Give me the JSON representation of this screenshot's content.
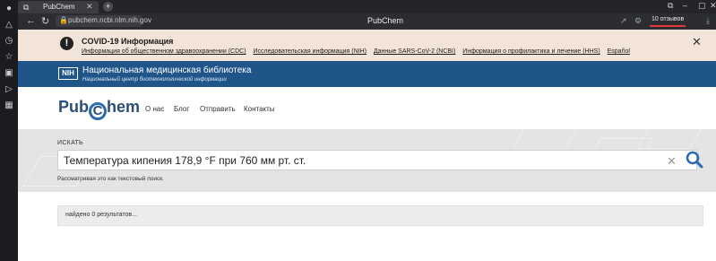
{
  "browser": {
    "tab": {
      "title": "PubChem",
      "favicon": "copy-icon"
    },
    "url": "pubchem.ncbi.nlm.nih.gov",
    "page_title": "PubChem",
    "reviews_label": "10 отзывов"
  },
  "covid": {
    "title": "COVID-19 Информация",
    "links": [
      "Информация об общественном здравоохранении (CDC)",
      "Исследовательская информация (NIH)",
      "Данные SARS-CoV-2 (NCBI)",
      "Информация о профилактика и лечение (HHS)",
      "Español"
    ]
  },
  "nlm": {
    "logo": "NIH",
    "title": "Национальная медицинская библиотека",
    "subtitle": "Национальный центр биотехнологической информации"
  },
  "pubchem": {
    "logo_left": "Pub",
    "logo_ring": "C",
    "logo_right": "hem",
    "nav": [
      "О нас",
      "Блог",
      "Отправить",
      "Контакты"
    ]
  },
  "search": {
    "label": "ИСКАТЬ",
    "value": "Температура кипения 178,9 °F при 760 мм рт. ст.",
    "hint": "Рассматривая это как текстовый поиск."
  },
  "results": {
    "text": "найдено 0 результатов..."
  },
  "colors": {
    "nlm_bar": "#20558a",
    "covid_bg": "#f2e4d8",
    "search_icon": "#2b6cb0"
  }
}
